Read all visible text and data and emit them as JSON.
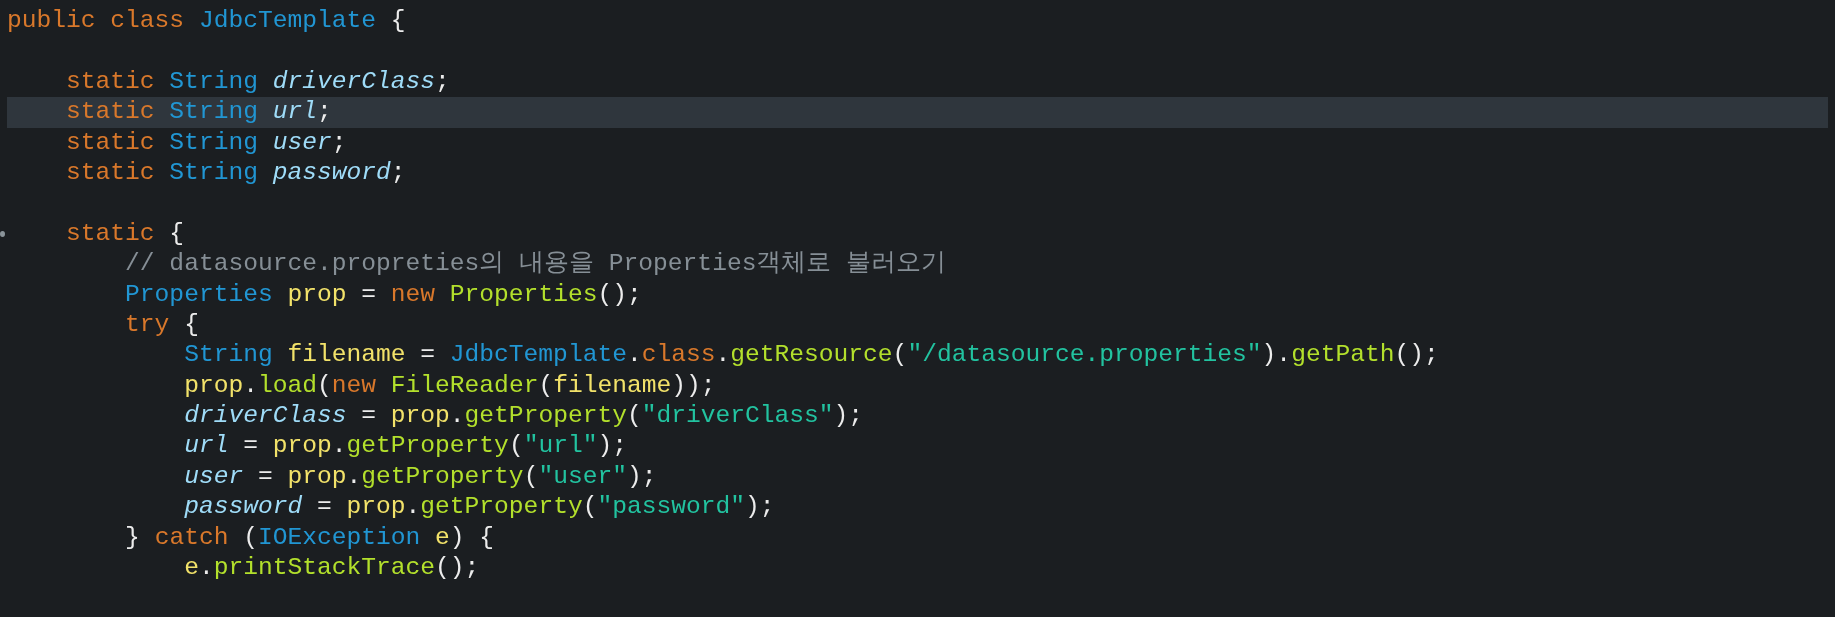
{
  "editor": {
    "lines": [
      {
        "highlighted": false,
        "marker": false,
        "tokens": [
          {
            "kind": "keyword",
            "text": "public class "
          },
          {
            "kind": "type",
            "text": "JdbcTemplate"
          },
          {
            "kind": "plain",
            "text": " {"
          }
        ],
        "children": [
          {
            "highlighted": false,
            "marker": false
          },
          {
            "highlighted": false,
            "marker": false,
            "tokens": [
              {
                "kind": "keyword",
                "text": "static "
              },
              {
                "kind": "type",
                "text": "String "
              },
              {
                "kind": "field",
                "text": "driverClass"
              },
              {
                "kind": "plain",
                "text": ";"
              }
            ]
          },
          {
            "highlighted": true,
            "marker": false,
            "tokens": [
              {
                "kind": "keyword",
                "text": "static "
              },
              {
                "kind": "type",
                "text": "String "
              },
              {
                "kind": "field",
                "text": "url"
              },
              {
                "kind": "plain",
                "text": ";"
              }
            ]
          },
          {
            "highlighted": false,
            "marker": false,
            "tokens": [
              {
                "kind": "keyword",
                "text": "static "
              },
              {
                "kind": "type",
                "text": "String "
              },
              {
                "kind": "field",
                "text": "user"
              },
              {
                "kind": "plain",
                "text": ";"
              }
            ]
          },
          {
            "highlighted": false,
            "marker": false,
            "tokens": [
              {
                "kind": "keyword",
                "text": "static "
              },
              {
                "kind": "type",
                "text": "String "
              },
              {
                "kind": "field",
                "text": "password"
              },
              {
                "kind": "plain",
                "text": ";"
              }
            ]
          },
          {
            "highlighted": false,
            "marker": false
          },
          {
            "highlighted": false,
            "marker": true,
            "tokens": [
              {
                "kind": "keyword",
                "text": "static"
              },
              {
                "kind": "plain",
                "text": " {"
              }
            ],
            "children": [
              {
                "highlighted": false,
                "marker": false,
                "tokens": [
                  {
                    "kind": "comment",
                    "text": "// datasource.propreties의 내용을 Properties객체로 불러오기"
                  }
                ]
              },
              {
                "highlighted": false,
                "marker": false,
                "tokens": [
                  {
                    "kind": "type",
                    "text": "Properties "
                  },
                  {
                    "kind": "local",
                    "text": "prop"
                  },
                  {
                    "kind": "plain",
                    "text": " = "
                  },
                  {
                    "kind": "keyword",
                    "text": "new "
                  },
                  {
                    "kind": "method",
                    "text": "Properties"
                  },
                  {
                    "kind": "plain",
                    "text": "();"
                  }
                ]
              },
              {
                "highlighted": false,
                "marker": false,
                "tokens": [
                  {
                    "kind": "keyword",
                    "text": "try"
                  },
                  {
                    "kind": "plain",
                    "text": " {"
                  }
                ],
                "children": [
                  {
                    "highlighted": false,
                    "marker": false,
                    "tokens": [
                      {
                        "kind": "type",
                        "text": "String "
                      },
                      {
                        "kind": "local",
                        "text": "filename"
                      },
                      {
                        "kind": "plain",
                        "text": " = "
                      },
                      {
                        "kind": "type",
                        "text": "JdbcTemplate"
                      },
                      {
                        "kind": "plain",
                        "text": "."
                      },
                      {
                        "kind": "keyword",
                        "text": "class"
                      },
                      {
                        "kind": "plain",
                        "text": "."
                      },
                      {
                        "kind": "method",
                        "text": "getResource"
                      },
                      {
                        "kind": "plain",
                        "text": "("
                      },
                      {
                        "kind": "string",
                        "text": "\"/datasource.properties\""
                      },
                      {
                        "kind": "plain",
                        "text": ")."
                      },
                      {
                        "kind": "method",
                        "text": "getPath"
                      },
                      {
                        "kind": "plain",
                        "text": "();"
                      }
                    ]
                  },
                  {
                    "highlighted": false,
                    "marker": false,
                    "tokens": [
                      {
                        "kind": "local",
                        "text": "prop"
                      },
                      {
                        "kind": "plain",
                        "text": "."
                      },
                      {
                        "kind": "method",
                        "text": "load"
                      },
                      {
                        "kind": "plain",
                        "text": "("
                      },
                      {
                        "kind": "keyword",
                        "text": "new "
                      },
                      {
                        "kind": "method",
                        "text": "FileReader"
                      },
                      {
                        "kind": "plain",
                        "text": "("
                      },
                      {
                        "kind": "local",
                        "text": "filename"
                      },
                      {
                        "kind": "plain",
                        "text": "));"
                      }
                    ]
                  },
                  {
                    "highlighted": false,
                    "marker": false,
                    "tokens": [
                      {
                        "kind": "field",
                        "text": "driverClass"
                      },
                      {
                        "kind": "plain",
                        "text": " = "
                      },
                      {
                        "kind": "local",
                        "text": "prop"
                      },
                      {
                        "kind": "plain",
                        "text": "."
                      },
                      {
                        "kind": "method",
                        "text": "getProperty"
                      },
                      {
                        "kind": "plain",
                        "text": "("
                      },
                      {
                        "kind": "string",
                        "text": "\"driverClass\""
                      },
                      {
                        "kind": "plain",
                        "text": ");"
                      }
                    ]
                  },
                  {
                    "highlighted": false,
                    "marker": false,
                    "tokens": [
                      {
                        "kind": "field",
                        "text": "url"
                      },
                      {
                        "kind": "plain",
                        "text": " = "
                      },
                      {
                        "kind": "local",
                        "text": "prop"
                      },
                      {
                        "kind": "plain",
                        "text": "."
                      },
                      {
                        "kind": "method",
                        "text": "getProperty"
                      },
                      {
                        "kind": "plain",
                        "text": "("
                      },
                      {
                        "kind": "string",
                        "text": "\"url\""
                      },
                      {
                        "kind": "plain",
                        "text": ");"
                      }
                    ]
                  },
                  {
                    "highlighted": false,
                    "marker": false,
                    "tokens": [
                      {
                        "kind": "field",
                        "text": "user"
                      },
                      {
                        "kind": "plain",
                        "text": " = "
                      },
                      {
                        "kind": "local",
                        "text": "prop"
                      },
                      {
                        "kind": "plain",
                        "text": "."
                      },
                      {
                        "kind": "method",
                        "text": "getProperty"
                      },
                      {
                        "kind": "plain",
                        "text": "("
                      },
                      {
                        "kind": "string",
                        "text": "\"user\""
                      },
                      {
                        "kind": "plain",
                        "text": ");"
                      }
                    ]
                  },
                  {
                    "highlighted": false,
                    "marker": false,
                    "tokens": [
                      {
                        "kind": "field",
                        "text": "password"
                      },
                      {
                        "kind": "plain",
                        "text": " = "
                      },
                      {
                        "kind": "local",
                        "text": "prop"
                      },
                      {
                        "kind": "plain",
                        "text": "."
                      },
                      {
                        "kind": "method",
                        "text": "getProperty"
                      },
                      {
                        "kind": "plain",
                        "text": "("
                      },
                      {
                        "kind": "string",
                        "text": "\"password\""
                      },
                      {
                        "kind": "plain",
                        "text": ");"
                      }
                    ]
                  }
                ]
              },
              {
                "highlighted": false,
                "marker": false,
                "tokens": [
                  {
                    "kind": "plain",
                    "text": "} "
                  },
                  {
                    "kind": "keyword",
                    "text": "catch"
                  },
                  {
                    "kind": "plain",
                    "text": " ("
                  },
                  {
                    "kind": "type",
                    "text": "IOException "
                  },
                  {
                    "kind": "local",
                    "text": "e"
                  },
                  {
                    "kind": "plain",
                    "text": ") {"
                  }
                ],
                "children": [
                  {
                    "highlighted": false,
                    "marker": false,
                    "tokens": [
                      {
                        "kind": "local",
                        "text": "e"
                      },
                      {
                        "kind": "plain",
                        "text": "."
                      },
                      {
                        "kind": "method",
                        "text": "printStackTrace"
                      },
                      {
                        "kind": "plain",
                        "text": "();"
                      }
                    ]
                  }
                ]
              }
            ]
          }
        ]
      }
    ]
  }
}
